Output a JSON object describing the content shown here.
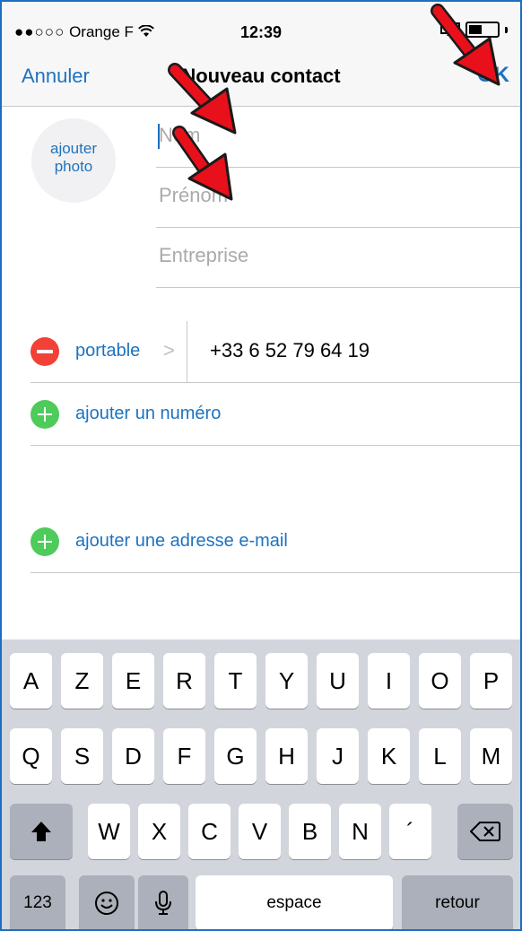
{
  "status": {
    "dots": "●●○○○",
    "carrier": "Orange F",
    "wifi": "᾽",
    "time": "12:39"
  },
  "nav": {
    "cancel_label": "Annuler",
    "title": "Nouveau contact",
    "ok_label": "OK"
  },
  "photo": {
    "label_line1": "ajouter",
    "label_line2": "photo"
  },
  "fields": {
    "name_placeholder": "Nom",
    "first_name_placeholder": "Prénom",
    "company_placeholder": "Entreprise"
  },
  "phone": {
    "label": "portable",
    "chevron": ">",
    "number": "+33 6 52 79 64 19"
  },
  "add_number_label": "ajouter un numéro",
  "add_email_label": "ajouter une adresse e-mail",
  "keyboard": {
    "row1": [
      "A",
      "Z",
      "E",
      "R",
      "T",
      "Y",
      "U",
      "I",
      "O",
      "P"
    ],
    "row2": [
      "Q",
      "S",
      "D",
      "F",
      "G",
      "H",
      "J",
      "K",
      "L",
      "M"
    ],
    "row3": [
      "W",
      "X",
      "C",
      "V",
      "B",
      "N",
      "´"
    ],
    "numbers_label": "123",
    "space_label": "espace",
    "return_label": "retour"
  },
  "colors": {
    "accent": "#1d73bf",
    "delete": "#f24137",
    "add": "#4ecb5b",
    "annotation_arrow": "#e8101b"
  }
}
